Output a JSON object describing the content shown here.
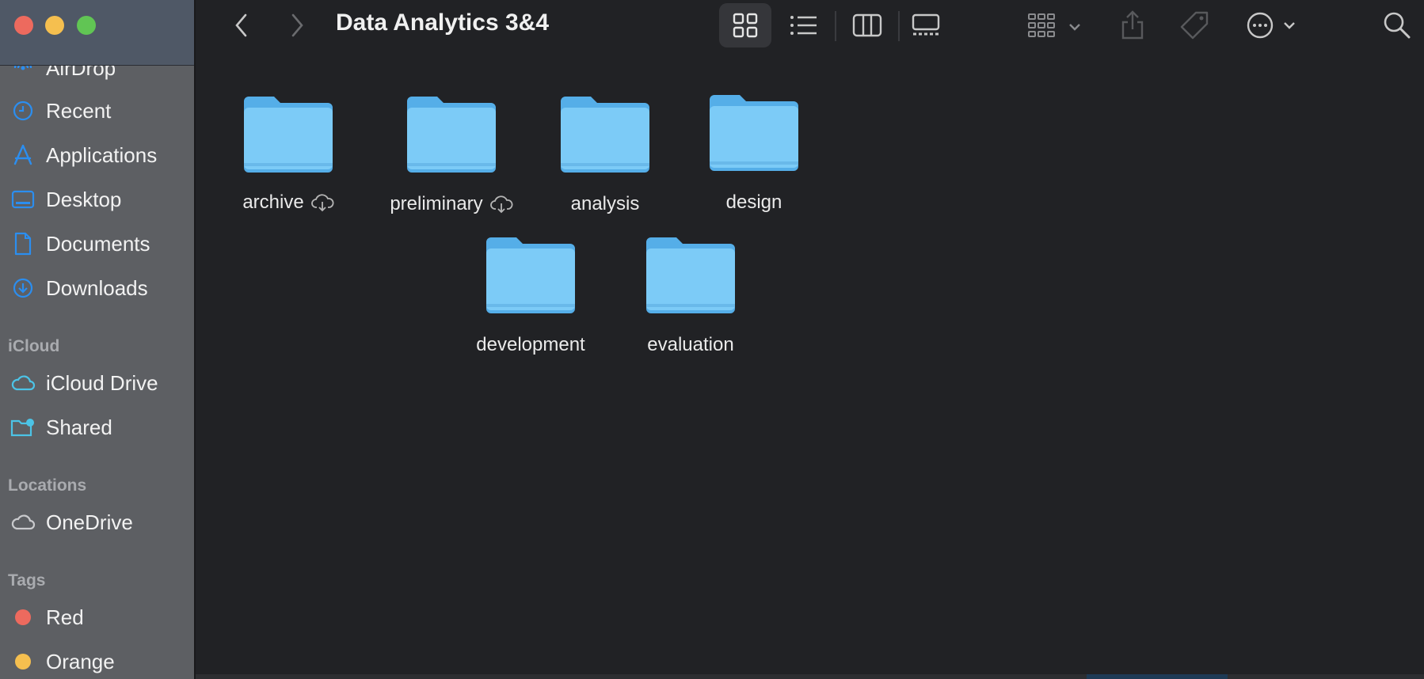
{
  "window": {
    "title": "Data Analytics 3&4"
  },
  "sidebar": {
    "favorites": [
      {
        "label": "AirDrop",
        "icon": "airdrop-icon"
      },
      {
        "label": "Recent",
        "icon": "clock-icon"
      },
      {
        "label": "Applications",
        "icon": "applications-icon"
      },
      {
        "label": "Desktop",
        "icon": "desktop-icon"
      },
      {
        "label": "Documents",
        "icon": "document-icon"
      },
      {
        "label": "Downloads",
        "icon": "download-icon"
      }
    ],
    "icloud_header": "iCloud",
    "icloud": [
      {
        "label": "iCloud Drive",
        "icon": "icloud-icon"
      },
      {
        "label": "Shared",
        "icon": "shared-folder-icon"
      }
    ],
    "locations_header": "Locations",
    "locations": [
      {
        "label": "OneDrive",
        "icon": "cloud-icon"
      }
    ],
    "tags_header": "Tags",
    "tags": [
      {
        "label": "Red",
        "color": "#ed6a5e"
      },
      {
        "label": "Orange",
        "color": "#f5bf4f"
      }
    ]
  },
  "toolbar": {
    "buttons": [
      "back-icon",
      "forward-icon",
      "icon-view-icon",
      "list-view-icon",
      "column-view-icon",
      "gallery-view-icon",
      "group-by-icon",
      "share-icon",
      "tag-icon",
      "more-actions-icon",
      "search-icon"
    ]
  },
  "folders": [
    {
      "name": "archive",
      "cloud": true
    },
    {
      "name": "preliminary",
      "cloud": true
    },
    {
      "name": "analysis",
      "cloud": false
    },
    {
      "name": "design",
      "cloud": false
    },
    {
      "name": "development",
      "cloud": false
    },
    {
      "name": "evaluation",
      "cloud": false
    }
  ],
  "colors": {
    "sidebar_accent": "#2b8ef0",
    "icloud_accent": "#4cc3e6",
    "folder_blue": "#7ccbf7"
  }
}
